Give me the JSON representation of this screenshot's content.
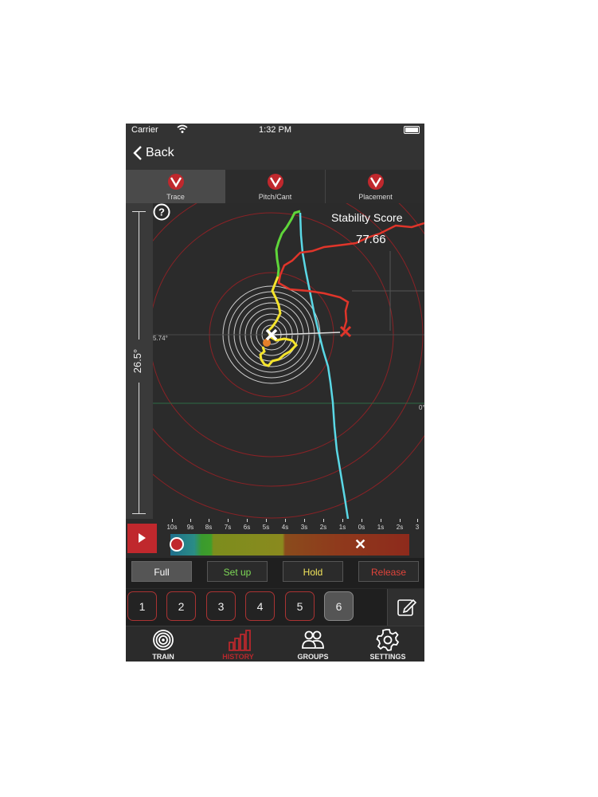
{
  "status_bar": {
    "carrier": "Carrier",
    "time": "1:32 PM"
  },
  "nav": {
    "back_label": "Back"
  },
  "tabs": [
    {
      "label": "Trace",
      "active": true,
      "icon": "brand-logo-icon"
    },
    {
      "label": "Pitch/Cant",
      "active": false,
      "icon": "brand-logo-icon"
    },
    {
      "label": "Placement",
      "active": false,
      "icon": "brand-logo-icon"
    }
  ],
  "plot": {
    "vertical_scale_label": "26.5°",
    "angle_label": "5.74°",
    "zero_label": "0°",
    "stability_title": "Stability Score",
    "stability_value": "77.66"
  },
  "timeline": {
    "ticks": [
      "10s",
      "9s",
      "8s",
      "7s",
      "6s",
      "5s",
      "4s",
      "3s",
      "2s",
      "1s",
      "0s",
      "1s",
      "2s",
      "3"
    ]
  },
  "phases": {
    "full": "Full",
    "setup": "Set up",
    "hold": "Hold",
    "release": "Release"
  },
  "shots": [
    "1",
    "2",
    "3",
    "4",
    "5",
    "6"
  ],
  "selected_shot": "6",
  "bottom_tabs": [
    {
      "label": "TRAIN",
      "icon": "target-icon",
      "active": false
    },
    {
      "label": "HISTORY",
      "icon": "bar-chart-icon",
      "active": true
    },
    {
      "label": "GROUPS",
      "icon": "people-icon",
      "active": false
    },
    {
      "label": "SETTINGS",
      "icon": "gear-icon",
      "active": false
    }
  ],
  "colors": {
    "accent_red": "#c0282d",
    "setup_green": "#7ed957",
    "hold_yellow": "#f2e55b",
    "release_red": "#e0443b",
    "trace_cyan": "#5ad8e6"
  }
}
